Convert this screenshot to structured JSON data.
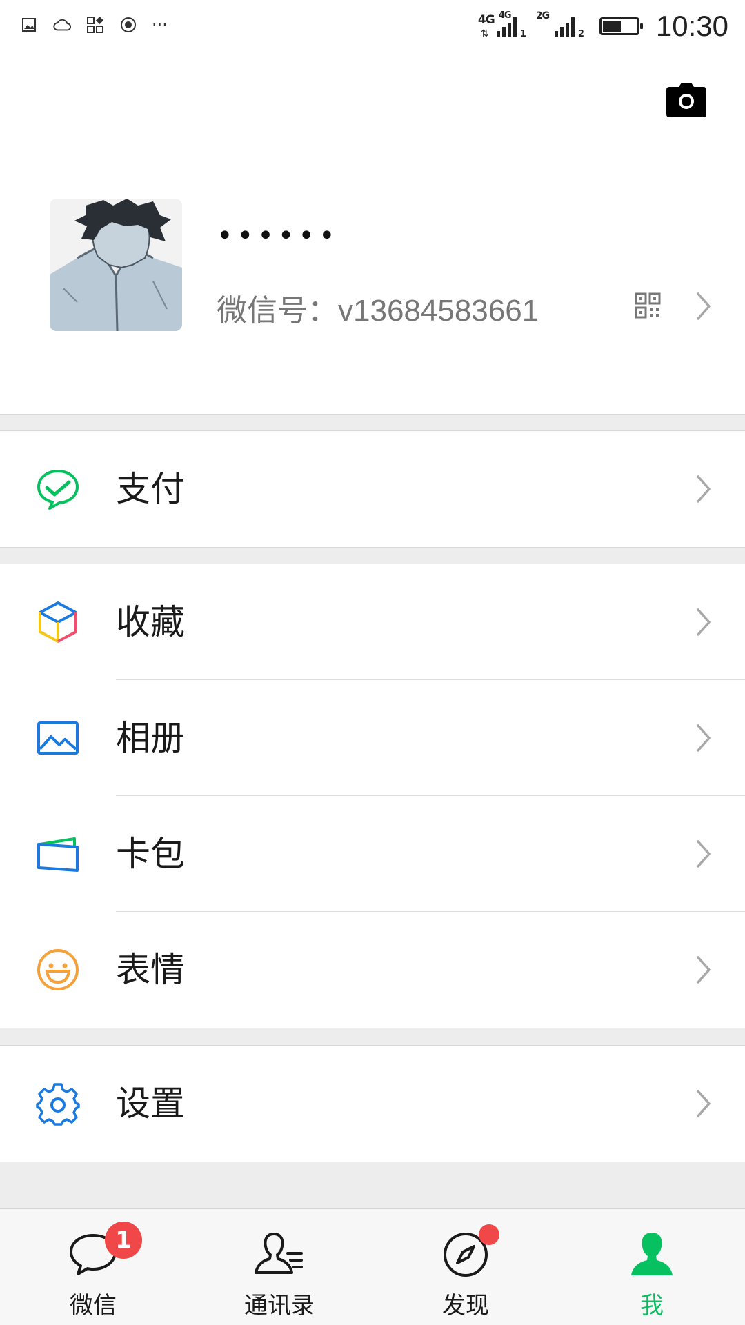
{
  "status_bar": {
    "network_1": "4G",
    "network_2": "4G",
    "slot_1": "1",
    "network_3": "2G",
    "slot_2": "2",
    "battery_level": 0.55,
    "time": "10:30",
    "overflow": "···"
  },
  "profile": {
    "nickname": "••••••",
    "wechat_id": "微信号：v13684583661"
  },
  "menu": {
    "pay": "支付",
    "favorites": "收藏",
    "album": "相册",
    "cards": "卡包",
    "stickers": "表情",
    "settings": "设置"
  },
  "tabbar": {
    "chats": "微信",
    "chats_badge": "1",
    "contacts": "通讯录",
    "discover": "发现",
    "me": "我"
  },
  "colors": {
    "accent": "#07c160",
    "badge": "#f04848",
    "icon_blue": "#1a7ae0",
    "icon_orange": "#f5a13a"
  }
}
